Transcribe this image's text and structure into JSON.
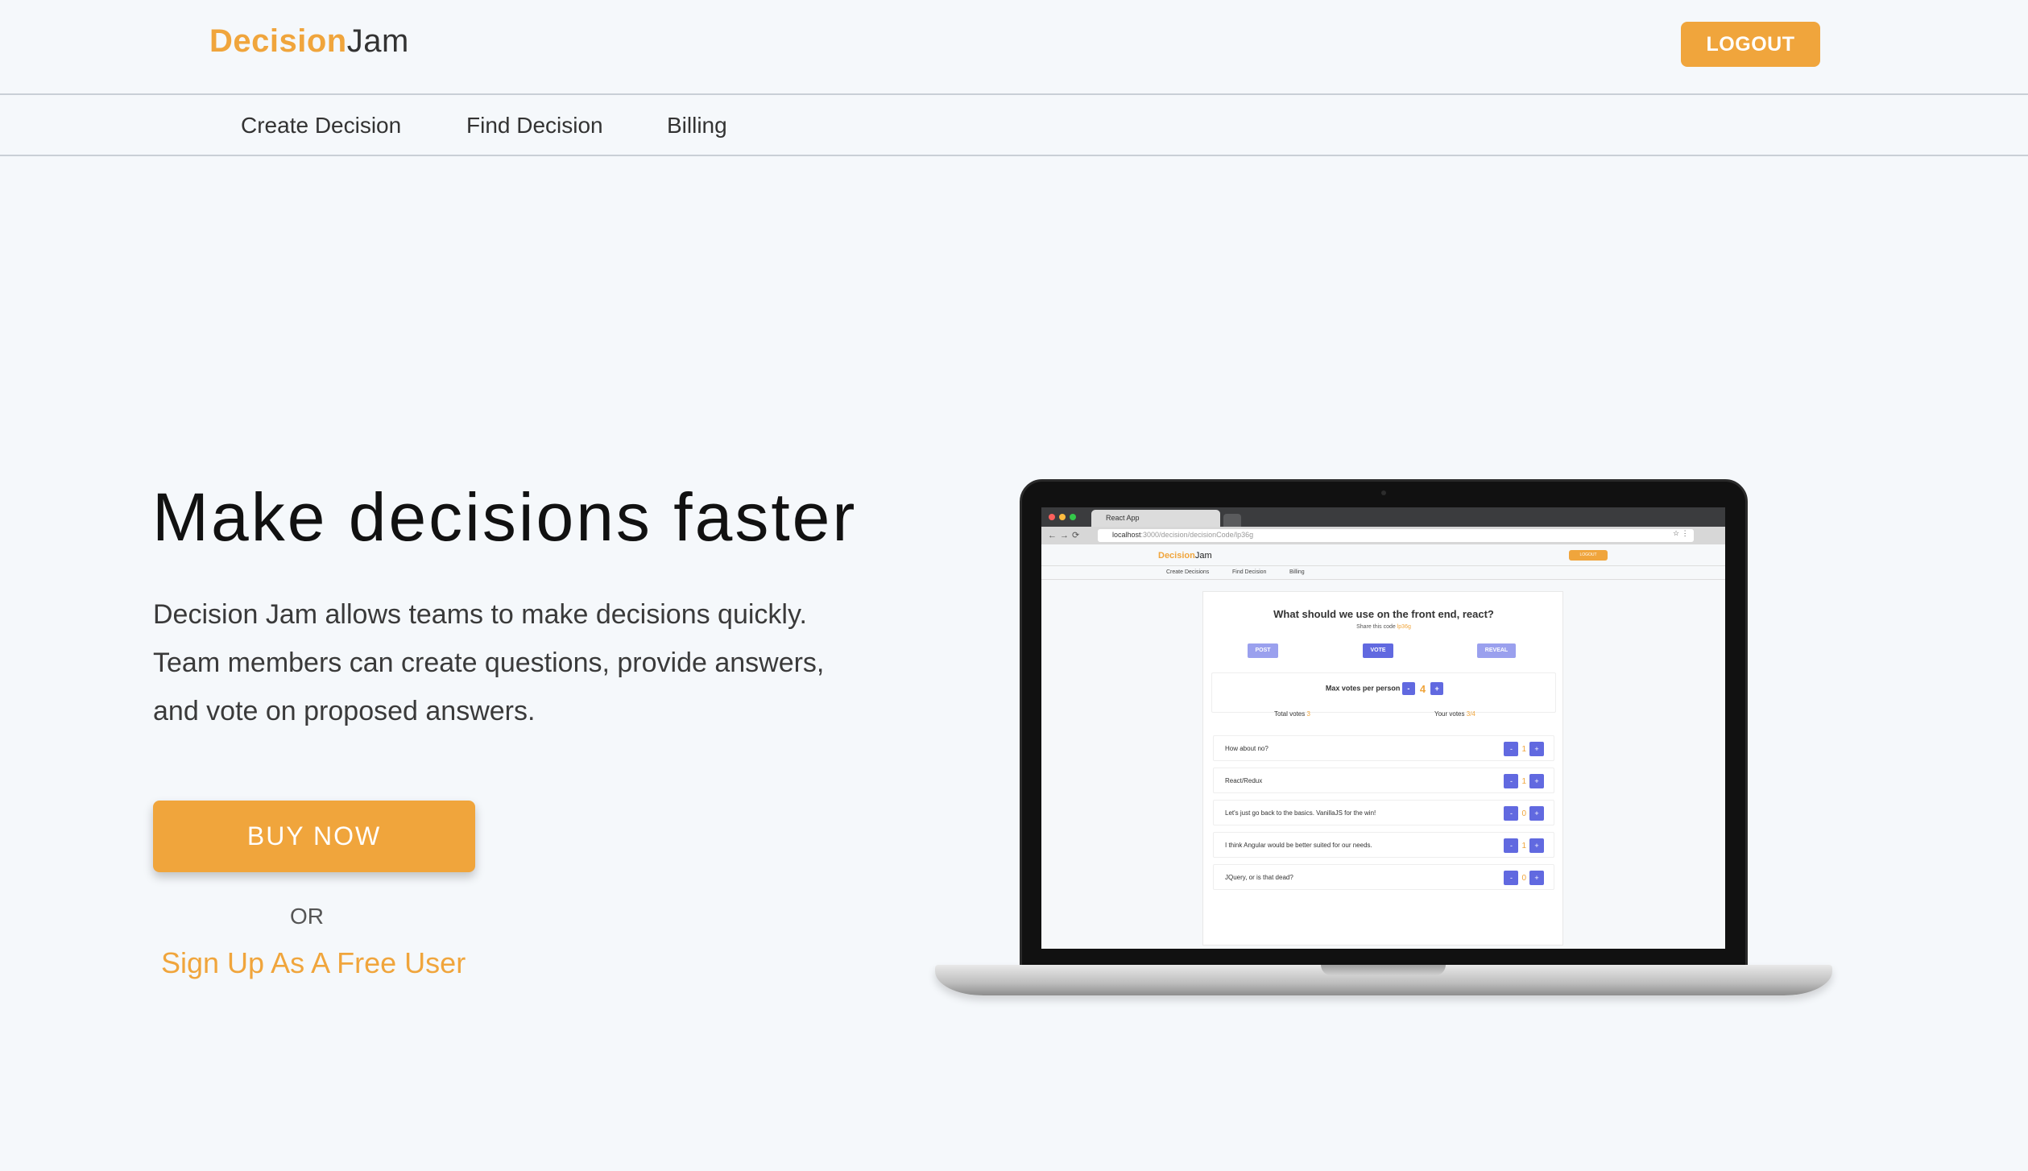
{
  "colors": {
    "accent": "#f0a53c",
    "vote_button": "#6169e0",
    "background": "#f5f8fb"
  },
  "header": {
    "logo_primary": "Decision",
    "logo_secondary": "Jam",
    "logout_label": "LOGOUT"
  },
  "nav": {
    "items": [
      "Create Decision",
      "Find Decision",
      "Billing"
    ]
  },
  "hero": {
    "headline": "Make decisions faster",
    "description_lines": [
      "Decision Jam allows teams to make decisions quickly.",
      "Team members can create questions, provide answers,",
      "and vote on proposed answers."
    ],
    "buy_label": "BUY NOW",
    "or_label": "OR",
    "signup_label": "Sign Up As A Free User"
  },
  "preview": {
    "tab_title": "React App",
    "url_host": "localhost",
    "url_path": ":3000/decision/decisionCode/lp36g",
    "logo_primary": "Decision",
    "logo_secondary": "Jam",
    "logout_label": "LOGOUT",
    "nav_items": [
      "Create Decisions",
      "Find Decision",
      "Billing"
    ],
    "question": "What should we use on the front end, react?",
    "share_label": "Share this code",
    "share_code": "lp36g",
    "phase_buttons": [
      "POST",
      "VOTE",
      "REVEAL"
    ],
    "max_votes_label": "Max votes per person",
    "max_votes_value": "4",
    "total_votes_label": "Total votes",
    "total_votes_value": "3",
    "your_votes_label": "Your votes",
    "your_votes_value": "3/4",
    "answers": [
      {
        "text": "How about no?",
        "votes": "1"
      },
      {
        "text": "React/Redux",
        "votes": "1"
      },
      {
        "text": "Let's just go back to the basics. VanillaJS for the win!",
        "votes": "0"
      },
      {
        "text": "I think Angular would be better suited for our needs.",
        "votes": "1"
      },
      {
        "text": "JQuery, or is that dead?",
        "votes": "0"
      }
    ],
    "minus": "-",
    "plus": "+"
  }
}
